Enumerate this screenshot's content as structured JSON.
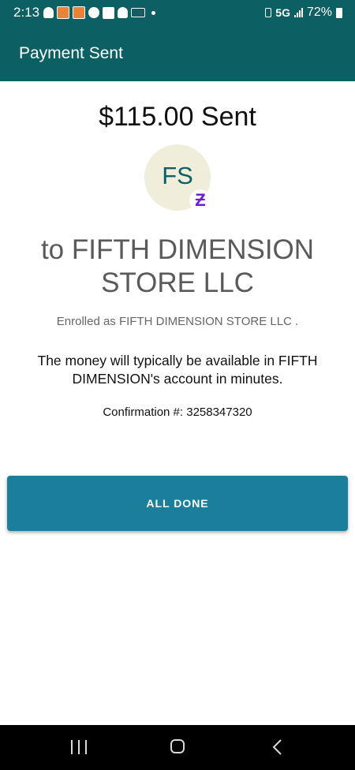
{
  "status_bar": {
    "time": "2:13",
    "network": "5G",
    "battery": "72%",
    "notification_icons": [
      "snapchat-icon",
      "taco-bell-icon",
      "taco-bell-icon",
      "facebook-icon",
      "c-icon",
      "snapchat-icon",
      "lyft-icon",
      "dot-icon"
    ]
  },
  "header": {
    "title": "Payment Sent"
  },
  "payment": {
    "amount_text": "$115.00 Sent",
    "avatar_initials": "FS",
    "badge_icon": "zelle-icon",
    "recipient_line": "to FIFTH DIMENSION STORE LLC",
    "enrolled_text": "Enrolled as FIFTH DIMENSION STORE LLC .",
    "availability_text": "The money will typically be available in FIFTH DIMENSION's account in minutes.",
    "confirmation_text": "Confirmation #: 3258347320"
  },
  "actions": {
    "done_label": "ALL DONE"
  },
  "colors": {
    "header_bg": "#0c5f63",
    "button_bg": "#1b7f9c",
    "avatar_bg": "#f0eedb",
    "zelle_purple": "#6d1ed4"
  },
  "nav": {
    "icons": [
      "recents-icon",
      "home-icon",
      "back-icon"
    ]
  }
}
